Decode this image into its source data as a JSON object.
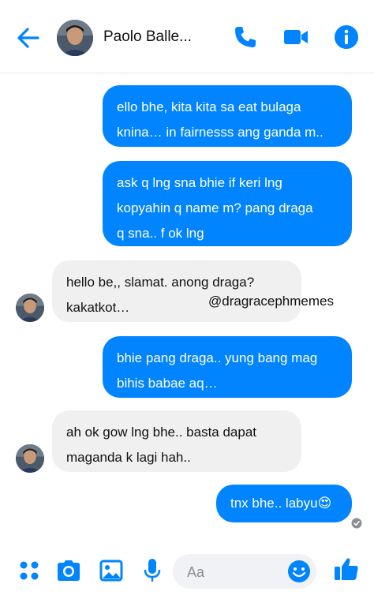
{
  "header": {
    "contact_name": "Paolo Balle..."
  },
  "messages": [
    {
      "direction": "outgoing",
      "text": "ello bhe, kita kita sa eat bulaga\nknina… in fairnesss ang ganda m.."
    },
    {
      "direction": "outgoing",
      "text": "ask q lng sna bhie if keri lng\nkopyahin q name m? pang draga\nq sna.. f ok lng"
    },
    {
      "direction": "incoming",
      "text": "hello be,, slamat. anong draga?\nkakatkot…"
    },
    {
      "direction": "outgoing",
      "text": "bhie pang draga.. yung bang mag\nbihis babae aq…"
    },
    {
      "direction": "incoming",
      "text": "ah ok gow lng bhe.. basta dapat\nmaganda k lagi hah.."
    },
    {
      "direction": "outgoing",
      "text": "tnx bhe.. labyu😍"
    }
  ],
  "watermark": "@dragracephmemes",
  "composer": {
    "placeholder": "Aa"
  },
  "colors": {
    "accent": "#0084ff",
    "incoming_bubble": "#f0f0f0"
  },
  "icons": [
    "back-arrow-icon",
    "phone-icon",
    "video-camera-icon",
    "info-icon",
    "apps-grid-icon",
    "camera-icon",
    "image-icon",
    "microphone-icon",
    "emoji-icon",
    "thumbs-up-icon",
    "seen-check-icon"
  ]
}
